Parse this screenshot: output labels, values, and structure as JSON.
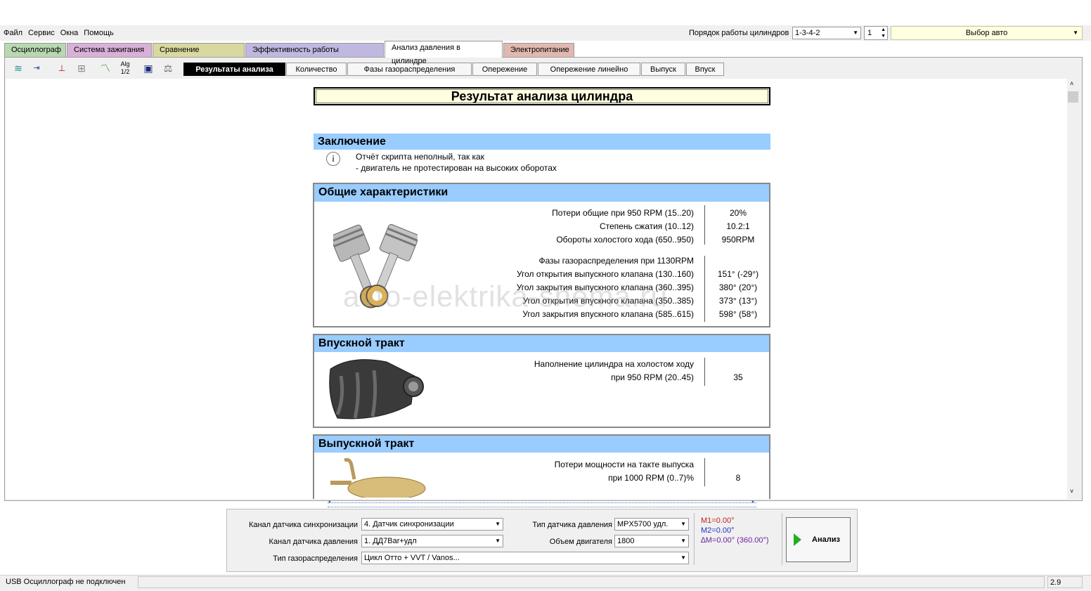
{
  "menu": [
    "Файл",
    "Сервис",
    "Окна",
    "Помощь"
  ],
  "toolbar_right": {
    "order_label": "Порядок работы цилиндров",
    "order_value": "1-3-4-2",
    "cylinder_value": "1",
    "car_select": "Выбор авто"
  },
  "main_tabs": [
    {
      "label": "Осциллограф",
      "color": "#b8d8b0"
    },
    {
      "label": "Система зажигания",
      "color": "#d8b0d8"
    },
    {
      "label": "Сравнение цилиндров",
      "color": "#d8d8a0"
    },
    {
      "label": "Эффективность работы цилиндров",
      "color": "#c0b8e0"
    },
    {
      "label": "Анализ давления в цилиндре",
      "color": "#ffffff"
    },
    {
      "label": "Электропитание",
      "color": "#e0b8b0"
    }
  ],
  "tool_icons": [
    "waveform-icon",
    "counter-icon",
    "auto-scale-icon",
    "grid-icon",
    "trend-icon",
    "algorithm-icon",
    "save-icon",
    "scales-icon"
  ],
  "sub_tabs": [
    "Результаты анализа",
    "Количество",
    "Фазы газораспределения",
    "Опережение",
    "Опережение линейно",
    "Выпуск",
    "Впуск"
  ],
  "report": {
    "title": "Результат анализа цилиндра",
    "conclusion": {
      "heading": "Заключение",
      "line1": "Отчёт скрипта неполный, так как",
      "line2": "- двигатель не протестирован на высоких оборотах"
    },
    "general": {
      "heading": "Общие характеристики",
      "rows": [
        {
          "label": "Потери общие при 950 RPM (15..20)",
          "value": "20%"
        },
        {
          "label": "Степень сжатия (10..12)",
          "value": "10.2:1"
        },
        {
          "label": "Обороты холостого хода (650..950)",
          "value": "950RPM"
        }
      ],
      "phases_title": "Фазы газораспределения при 1130RPM",
      "phases": [
        {
          "label": "Угол открытия выпускного клапана (130..160)",
          "value": "151° (-29°)"
        },
        {
          "label": "Угол закрытия выпускного клапана (360..395)",
          "value": "380°  (20°)"
        },
        {
          "label": "Угол открытия впускного клапана (350..385)",
          "value": "373°  (13°)"
        },
        {
          "label": "Угол закрытия впускного клапана (585..615)",
          "value": "598°  (58°)"
        }
      ]
    },
    "intake": {
      "heading": "Впускной тракт",
      "label1": "Наполнение цилиндра на холостом ходу",
      "label2": "при 950 RPM (20..45)",
      "value": "35"
    },
    "exhaust": {
      "heading": "Выпускной тракт",
      "label1": "Потери мощности на такте выпуска",
      "label2": "при  1000 RPM (0..7)%",
      "value": "8"
    },
    "watermark": "avto-elektrika-shema.ru"
  },
  "settings": {
    "sync_label": "Канал датчика синхронизации",
    "sync_value": "4.  Датчик синхронизации",
    "pressure_channel_label": "Канал датчика давления",
    "pressure_channel_value": "1.  ДД7Bar+удл",
    "timing_label": "Тип газораспределения",
    "timing_value": "Цикл Отто + VVT / Vanos...",
    "sensor_type_label": "Тип датчика давления",
    "sensor_type_value": "MPX5700 удл.",
    "volume_label": "Объем двигателя",
    "volume_value": "1800",
    "m1": "M1=0.00°",
    "m2": "M2=0.00°",
    "dm": "∆M=0.00° (360.00°)",
    "analyze_label": "Анализ"
  },
  "status": {
    "left": "USB Осциллограф не подключен",
    "right": "2.9"
  }
}
